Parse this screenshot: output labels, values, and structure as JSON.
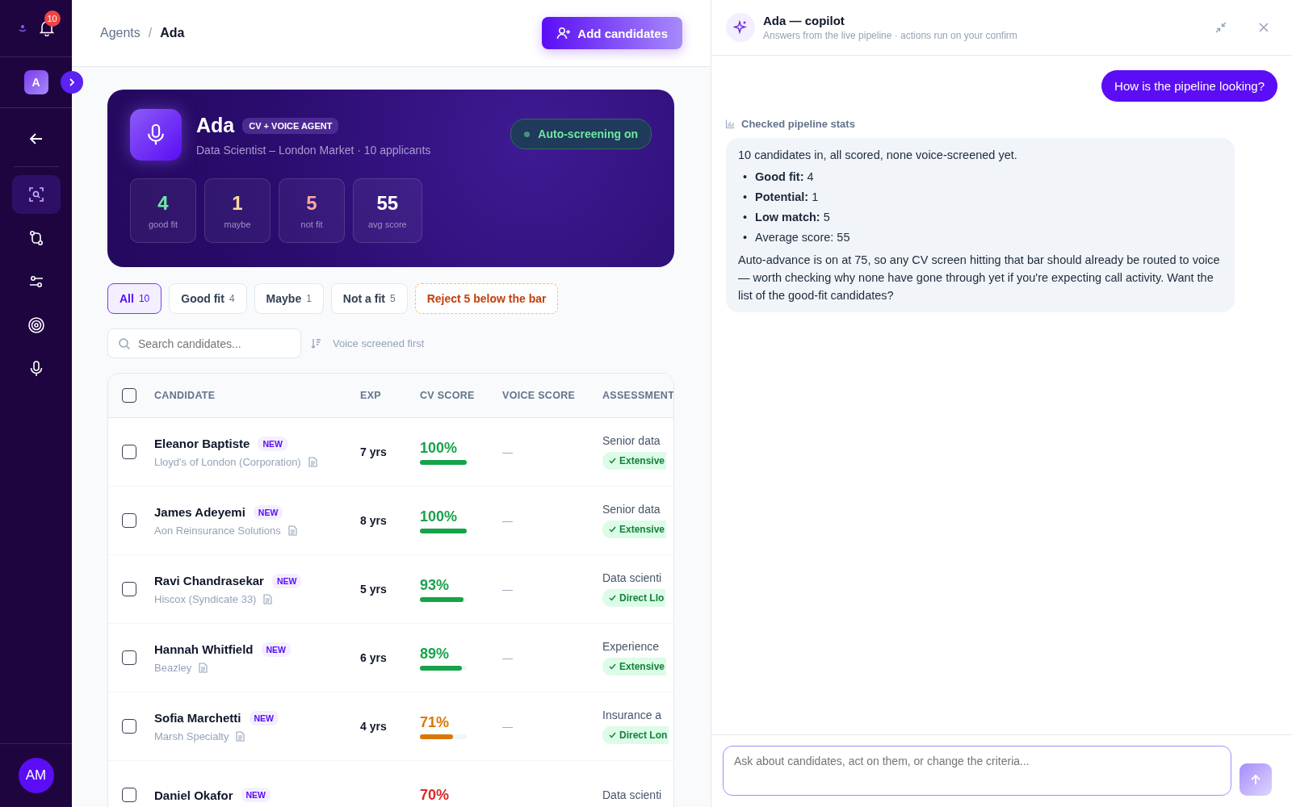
{
  "sidebar": {
    "notification_count": "10",
    "workspace_avatar": "A",
    "nav_items": [
      {
        "kind": "back",
        "selected": false
      },
      {
        "kind": "scan",
        "selected": true
      },
      {
        "kind": "flow",
        "selected": false
      },
      {
        "kind": "sliders",
        "selected": false
      },
      {
        "kind": "target",
        "selected": false
      },
      {
        "kind": "mic",
        "selected": false
      }
    ],
    "user_avatar": "AM"
  },
  "header": {
    "breadcrumb": [
      "Agents",
      "Ada"
    ],
    "breadcrumb_separator": "/",
    "add_button": "Add candidates"
  },
  "agent_card": {
    "name": "Ada",
    "tag": "CV + VOICE AGENT",
    "subtitle": "Data Scientist – London Market · 10 applicants",
    "status": {
      "label": "Auto-screening on",
      "on": true
    },
    "stats": [
      {
        "value": "4",
        "label": "good fit",
        "color": "#6ee7a0"
      },
      {
        "value": "1",
        "label": "maybe",
        "color": "#fcd9a0"
      },
      {
        "value": "5",
        "label": "not fit",
        "color": "#f9a8a0"
      },
      {
        "value": "55",
        "label": "avg score",
        "color": "#ffffff"
      }
    ]
  },
  "filters": [
    {
      "label": "All",
      "count": "10",
      "selected": true
    },
    {
      "label": "Good fit",
      "count": "4",
      "selected": false
    },
    {
      "label": "Maybe",
      "count": "1",
      "selected": false
    },
    {
      "label": "Not a fit",
      "count": "5",
      "selected": false
    }
  ],
  "reject_action": "Reject 5 below the bar",
  "search": {
    "placeholder": "Search candidates..."
  },
  "sort": "Voice screened first",
  "table": {
    "select_all_checked": false,
    "columns": [
      "CANDIDATE",
      "EXP",
      "CV SCORE",
      "VOICE SCORE",
      "ASSESSMENT"
    ],
    "rows": [
      {
        "name": "Eleanor Baptiste",
        "badge": "NEW",
        "company": "Lloyd's of London (Corporation)",
        "exp": "7 yrs",
        "score": "100%",
        "level": 1,
        "color": "#16a34a",
        "voice": "—",
        "assessment": "Senior data",
        "tag": "Extensive",
        "checked": false
      },
      {
        "name": "James Adeyemi",
        "badge": "NEW",
        "company": "Aon Reinsurance Solutions",
        "exp": "8 yrs",
        "score": "100%",
        "level": 1,
        "color": "#16a34a",
        "voice": "—",
        "assessment": "Senior data",
        "tag": "Extensive",
        "checked": false
      },
      {
        "name": "Ravi Chandrasekar",
        "badge": "NEW",
        "company": "Hiscox (Syndicate 33)",
        "exp": "5 yrs",
        "score": "93%",
        "level": 0.93,
        "color": "#16a34a",
        "voice": "—",
        "assessment": "Data scienti",
        "tag": "Direct Llo",
        "checked": false
      },
      {
        "name": "Hannah Whitfield",
        "badge": "NEW",
        "company": "Beazley",
        "exp": "6 yrs",
        "score": "89%",
        "level": 0.89,
        "color": "#16a34a",
        "voice": "—",
        "assessment": "Experience",
        "tag": "Extensive",
        "checked": false
      },
      {
        "name": "Sofia Marchetti",
        "badge": "NEW",
        "company": "Marsh Specialty",
        "exp": "4 yrs",
        "score": "71%",
        "level": 0.71,
        "color": "#d97706",
        "voice": "—",
        "assessment": "Insurance a",
        "tag": "Direct Lon",
        "checked": false
      },
      {
        "name": "Daniel Okafor",
        "badge": "NEW",
        "score": "70%",
        "color": "#dc2626",
        "assessment": "Data scienti",
        "checked": false
      }
    ]
  },
  "copilot": {
    "title": "Ada — copilot",
    "subtitle": "Answers from the live pipeline · actions run on your confirm",
    "user_message": "How is the pipeline looking?",
    "tool_step": "Checked pipeline stats",
    "reply": {
      "bullet_marker": "•",
      "intro": "10 candidates in, all scored, none voice-screened yet.",
      "bullets": [
        "**Good fit:** 4",
        "**Potential:** 1",
        "**Low match:** 5",
        "Average score: 55"
      ],
      "outro": "Auto-advance is on at 75, so any CV screen hitting that bar should already be routed to voice — worth checking why none have gone through yet if you're expecting call activity. Want the list of the good-fit candidates?"
    },
    "input": {
      "placeholder": "Ask about candidates, act on them, or change the criteria..."
    },
    "send_disabled": true
  }
}
